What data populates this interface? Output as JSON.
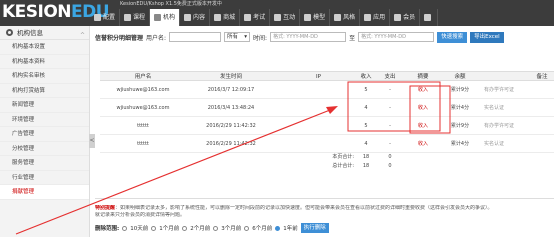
{
  "header": {
    "logo_main": "KESION",
    "logo_accent": "EDU",
    "top_note": "KesionEDU/Kshop X1.5免费正式版本开发中",
    "nav": [
      {
        "label": "配置",
        "icon": "gear-icon",
        "active": false
      },
      {
        "label": "课程",
        "icon": "book-icon",
        "active": false
      },
      {
        "label": "机构",
        "icon": "gear-icon",
        "active": true
      },
      {
        "label": "内容",
        "icon": "doc-icon",
        "active": false
      },
      {
        "label": "商城",
        "icon": "cart-icon",
        "active": false
      },
      {
        "label": "考试",
        "icon": "exam-icon",
        "active": false
      },
      {
        "label": "互动",
        "icon": "chat-icon",
        "active": false
      },
      {
        "label": "模型",
        "icon": "grid-icon",
        "active": false
      },
      {
        "label": "风格",
        "icon": "brush-icon",
        "active": false
      },
      {
        "label": "应用",
        "icon": "app-icon",
        "active": false
      },
      {
        "label": "会员",
        "icon": "user-icon",
        "active": false
      },
      {
        "label": "",
        "icon": "more-icon",
        "active": false
      }
    ]
  },
  "sidebar": {
    "title": "机构信息",
    "collapse": "^",
    "items": [
      "机构基本设置",
      "机构基本资料",
      "机构实名审核",
      "机构打赏结算",
      "新闻管理",
      "环境管理",
      "广告管理",
      "分校管理",
      "服务管理",
      "行业管理",
      "捐献管理"
    ],
    "toggle": "<"
  },
  "filters": {
    "title": "信誉积分明细管理",
    "user_label": "用户名:",
    "user_value": "",
    "select_value": "所有",
    "time_label": "时间:",
    "start_placeholder": "格式: YYYY-MM-DD",
    "to_label": "至",
    "end_placeholder": "格式: YYYY-MM-DD",
    "search_button": "快速搜索",
    "export_button": "导出Excel"
  },
  "table": {
    "headers": [
      "用户名",
      "发生时间",
      "IP",
      "收入",
      "支出",
      "摘要",
      "余额",
      "备注"
    ],
    "rows": [
      {
        "user": "wjiushuwe@163.com",
        "time": "2016/3/7 12:09:17",
        "ip": "",
        "income": "5",
        "expense": "-",
        "type": "收入",
        "balance": "累计9分",
        "remark": "有办学许可证"
      },
      {
        "user": "wjiushuwe@163.com",
        "time": "2016/3/4 13:48:24",
        "ip": "",
        "income": "4",
        "expense": "-",
        "type": "收入",
        "balance": "累计4分",
        "remark": "实名认证"
      },
      {
        "user": "tttttt",
        "time": "2016/2/29 11:42:32",
        "ip": "",
        "income": "5",
        "expense": "-",
        "type": "收入",
        "balance": "累计9分",
        "remark": "有办学许可证"
      },
      {
        "user": "tttttt",
        "time": "2016/2/29 11:42:32",
        "ip": "",
        "income": "4",
        "expense": "-",
        "type": "收入",
        "balance": "累计4分",
        "remark": "实名认证"
      }
    ],
    "page_total_label": "本页合计:",
    "page_total": [
      "18",
      "0"
    ],
    "grand_total_label": "总计合计:",
    "grand_total": [
      "18",
      "0"
    ]
  },
  "bottom": {
    "tip_label": "特别提醒",
    "tip_text": "：如果明细表记录太多，影响了系统性能，可以删除一定时间段前的记录以加快速度。但可能会带来会员在查看以前状过费的详细时重要收费（这样会引发会员大的争议）。",
    "tip_text2": "就记录来只分析会员的消费详情等问题。",
    "del_label": "删除范围:",
    "del_options": [
      "10天前",
      "1个月前",
      "2个月前",
      "3个月前",
      "6个月前",
      "1年前"
    ],
    "del_selected": 5,
    "del_button": "执行删除"
  },
  "colors": {
    "highlight": "#e53030",
    "accent": "#3e8fd6"
  }
}
